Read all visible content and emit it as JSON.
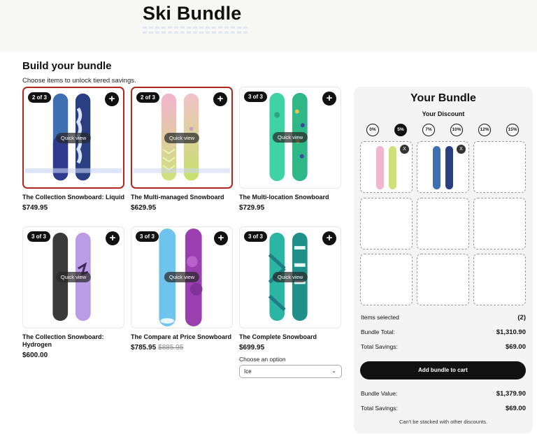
{
  "header": {
    "title": "Ski Bundle"
  },
  "builder": {
    "heading": "Build your bundle",
    "subheading": "Choose items to unlock tiered savings.",
    "quick_view_label": "Quick view",
    "products": [
      {
        "badge": "2 of 3",
        "name": "The Collection Snowboard: Liquid",
        "price": "$749.95",
        "compare_price": "",
        "selected": true
      },
      {
        "badge": "2 of 3",
        "name": "The Multi-managed Snowboard",
        "price": "$629.95",
        "compare_price": "",
        "selected": true
      },
      {
        "badge": "3 of 3",
        "name": "The Multi-location Snowboard",
        "price": "$729.95",
        "compare_price": "",
        "selected": false
      },
      {
        "badge": "3 of 3",
        "name": "The Collection Snowboard: Hydrogen",
        "price": "$600.00",
        "compare_price": "",
        "selected": false
      },
      {
        "badge": "3 of 3",
        "name": "The Compare at Price Snowboard",
        "price": "$785.95",
        "compare_price": "$885.95",
        "selected": false
      },
      {
        "badge": "3 of 3",
        "name": "The Complete Snowboard",
        "price": "$699.95",
        "compare_price": "",
        "selected": false
      }
    ],
    "option": {
      "label": "Choose an option",
      "value": "Ice"
    }
  },
  "bundle": {
    "title": "Your Bundle",
    "discount_title": "Your Discount",
    "tiers": [
      "0%",
      "5%",
      "7%",
      "10%",
      "12%",
      "15%"
    ],
    "active_tier": "5%",
    "remove_label": "X",
    "items_selected_label": "Items selected",
    "items_selected_value": "(2)",
    "bundle_total_label": "Bundle Total:",
    "bundle_total_value": "$1,310.90",
    "total_savings_label": "Total Savings:",
    "total_savings_value": "$69.00",
    "add_button": "Add bundle to cart",
    "bundle_value_label": "Bundle Value:",
    "bundle_value_value": "$1,379.90",
    "total_savings_label_2": "Total Savings:",
    "total_savings_value_2": "$69.00",
    "note": "Can't be stacked with other discounts."
  },
  "colors": {
    "accent": "#111111",
    "selected_border": "#b3261e",
    "panel_bg": "#f4f4f4"
  }
}
